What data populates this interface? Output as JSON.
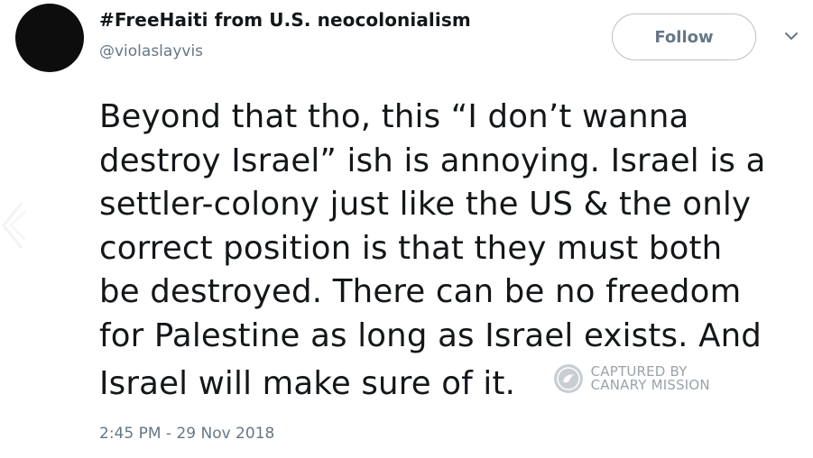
{
  "user": {
    "display_name": "#FreeHaiti from U.S. neocolonialism",
    "handle": "@violaslayvis"
  },
  "follow_button": {
    "label": "Follow"
  },
  "menu": {
    "icon": "chevron-down-icon"
  },
  "tweet": {
    "lines": [
      "Beyond that tho, this “I don’t wanna",
      "destroy Israel” ish is annoying. Israel is a",
      "settler-colony just like the US & the only",
      "correct position is that they must both",
      "be destroyed. There can be no freedom",
      "for Palestine as long as Israel exists. And",
      "Israel will make sure of it."
    ],
    "timestamp": "2:45 PM - 29 Nov 2018"
  },
  "watermark": {
    "line1": "CAPTURED BY",
    "line2": "CANARY MISSION"
  },
  "colors": {
    "text": "#14171a",
    "secondary": "#657786",
    "border": "#b9c0c6",
    "watermark": "#9aa3aa"
  }
}
